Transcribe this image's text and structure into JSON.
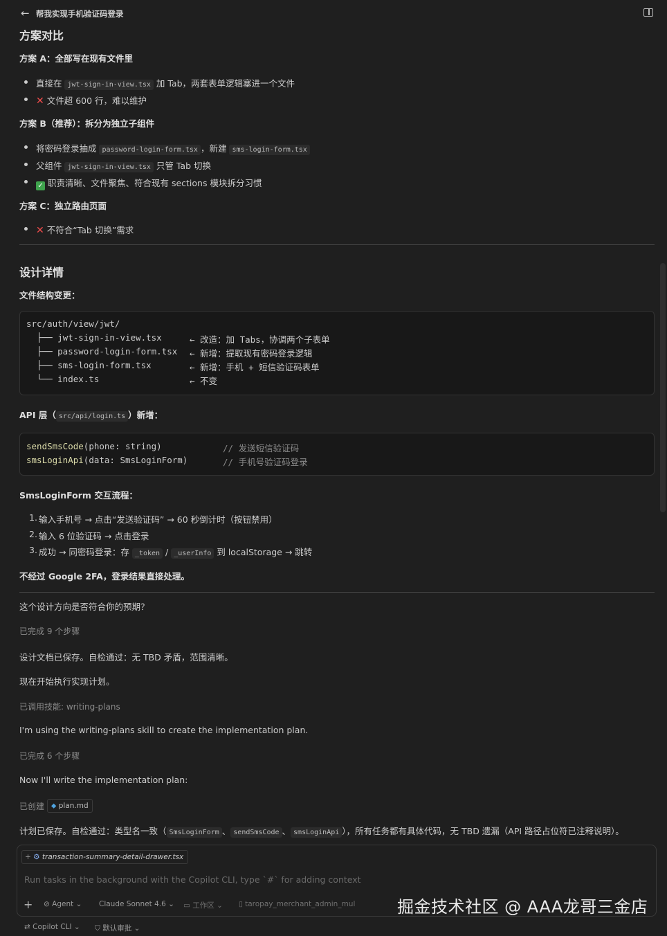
{
  "header": {
    "title": "帮我实现手机验证码登录"
  },
  "section1": {
    "heading": "方案对比",
    "a_title": "方案 A：全部写在现有文件里",
    "a_items": [
      {
        "pre": "直接在 ",
        "code": "jwt-sign-in-view.tsx",
        "post": " 加 Tab，两套表单逻辑塞进一个文件"
      },
      {
        "text": "文件超 600 行，难以维护"
      }
    ],
    "b_title": "方案 B（推荐）：拆分为独立子组件",
    "b_items": [
      {
        "pre": "将密码登录抽成 ",
        "code": "password-login-form.tsx",
        "mid": "，新建 ",
        "code2": "sms-login-form.tsx"
      },
      {
        "pre": "父组件 ",
        "code": "jwt-sign-in-view.tsx",
        "post": " 只管 Tab 切换"
      },
      {
        "text": "职责清晰、文件聚焦、符合现有 sections 模块拆分习惯"
      }
    ],
    "c_title": "方案 C：独立路由页面",
    "c_items": [
      {
        "text": "不符合“Tab 切换”需求"
      }
    ]
  },
  "section2": {
    "heading": "设计详情",
    "file_struct_title": "文件结构变更：",
    "tree": [
      {
        "path": "src/auth/view/jwt/",
        "note": ""
      },
      {
        "path": "  ├── jwt-sign-in-view.tsx",
        "note": "← 改造：加 Tabs，协调两个子表单"
      },
      {
        "path": "  ├── password-login-form.tsx",
        "note": "← 新增：提取现有密码登录逻辑"
      },
      {
        "path": "  ├── sms-login-form.tsx",
        "note": "← 新增：手机 + 短信验证码表单"
      },
      {
        "path": "  └── index.ts",
        "note": "← 不变"
      }
    ],
    "api_title_pre": "API 层（",
    "api_title_code": "src/api/login.ts",
    "api_title_post": "）新增：",
    "api_lines": [
      {
        "fn": "sendSmsCode",
        "args": "(phone: string)",
        "comment": "// 发送短信验证码"
      },
      {
        "fn": "smsLoginApi",
        "args": "(data: SmsLoginForm)",
        "comment": "// 手机号验证码登录"
      }
    ],
    "flow_title": "SmsLoginForm 交互流程：",
    "flow_items": [
      {
        "num": "1.",
        "text": "输入手机号 → 点击“发送验证码” → 60 秒倒计时（按钮禁用）"
      },
      {
        "num": "2.",
        "text": "输入 6 位验证码 → 点击登录"
      },
      {
        "num": "3.",
        "pre": "成功 → 同密码登录：存 ",
        "code": "_token",
        "mid": " / ",
        "code2": "_userInfo",
        "post": " 到 localStorage → 跳转"
      }
    ],
    "note": "不经过 Google 2FA，登录结果直接处理。"
  },
  "chat": {
    "question": "这个设计方向是否符合你的预期？",
    "done1": "已完成 9 个步骤",
    "saved": "设计文档已保存。自检通过：无 TBD 矛盾，范围清晰。",
    "start": "现在开始执行实现计划。",
    "skill": "已调用技能: writing-plans",
    "using": "I'm using the writing-plans skill to create the implementation plan.",
    "done2": "已完成 6 个步骤",
    "now": "Now I'll write the implementation plan:",
    "created_label": "已创建",
    "created_file": "plan.md",
    "final_pre": "计划已保存。自检通过：类型名一致（",
    "final_codes": [
      "SmsLoginForm",
      "sendSmsCode",
      "smsLoginApi"
    ],
    "final_post": "），所有任务都有具体代码，无 TBD 遗漏（API 路径占位符已注释说明）。"
  },
  "input": {
    "context_file": "transaction-summary-detail-drawer.tsx",
    "placeholder": "Run tasks in the background with the Copilot CLI, type `#` for adding context",
    "agent": "Agent",
    "model": "Claude Sonnet 4.6",
    "workspace": "工作区",
    "repo": "taropay_merchant_admin_mul",
    "cli": "Copilot CLI",
    "approval": "默认审批"
  },
  "watermark": "掘金技术社区 @ AAA龙哥三金店",
  "colors": {
    "background": "#1f1f1f",
    "function": "#dcdcaa",
    "error": "#f14c4c",
    "success": "#3fa34d"
  }
}
